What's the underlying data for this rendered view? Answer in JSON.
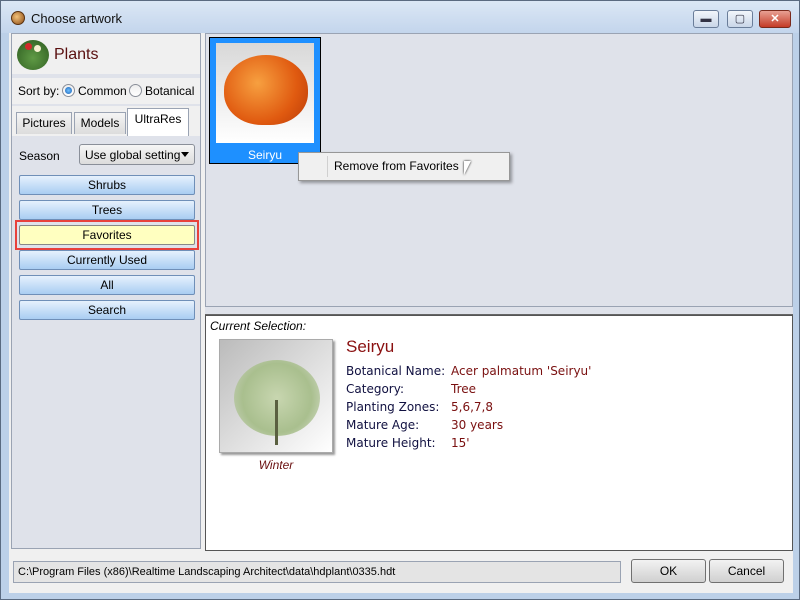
{
  "window": {
    "title": "Choose artwork",
    "minimize": "▬",
    "maximize": "▢",
    "close": "✕"
  },
  "sidebar": {
    "title": "Plants",
    "sort_label": "Sort by:",
    "sort_options": [
      {
        "label": "Common",
        "selected": true
      },
      {
        "label": "Botanical",
        "selected": false
      }
    ],
    "tabs": [
      {
        "label": "Pictures"
      },
      {
        "label": "Models"
      },
      {
        "label": "UltraRes",
        "active": true
      }
    ],
    "season_label": "Season",
    "season_value": "Use global setting",
    "categories": [
      {
        "label": "Shrubs"
      },
      {
        "label": "Trees"
      },
      {
        "label": "Favorites",
        "selected": true
      },
      {
        "label": "Currently Used"
      },
      {
        "label": "All"
      },
      {
        "label": "Search"
      }
    ]
  },
  "thumbnails": [
    {
      "label": "Seiryu",
      "selected": true
    }
  ],
  "context_menu": {
    "items": [
      {
        "label": "Remove from Favorites"
      }
    ]
  },
  "detail": {
    "heading": "Current Selection:",
    "name": "Seiryu",
    "image_caption": "Winter",
    "properties": [
      {
        "key": "Botanical Name:",
        "value": "Acer palmatum 'Seiryu'"
      },
      {
        "key": "Category:",
        "value": "Tree"
      },
      {
        "key": "Planting Zones:",
        "value": "5,6,7,8"
      },
      {
        "key": "Mature Age:",
        "value": "30 years"
      },
      {
        "key": "Mature Height:",
        "value": "15'"
      }
    ]
  },
  "footer": {
    "path": "C:\\Program Files (x86)\\Realtime Landscaping Architect\\data\\hdplant\\0335.hdt",
    "ok": "OK",
    "cancel": "Cancel"
  },
  "colors": {
    "selection": "#1e90ff",
    "favorites_highlight": "#ffffc0",
    "favorites_outline": "#e8413c",
    "accent_text": "#8a1010"
  }
}
